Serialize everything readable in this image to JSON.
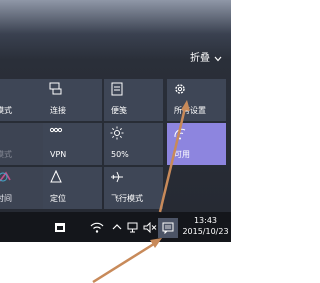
{
  "action_center": {
    "collapse_label": "折叠",
    "tiles": [
      {
        "label": "模式",
        "icon": "tablet-mode-icon"
      },
      {
        "label": "连接",
        "icon": "connect-icon"
      },
      {
        "label": "便笺",
        "icon": "note-icon"
      },
      {
        "label": "所有设置",
        "icon": "gear-icon"
      },
      {
        "label": "模式",
        "icon": "battery-saver-icon"
      },
      {
        "label": "VPN",
        "icon": "vpn-icon"
      },
      {
        "label": "50%",
        "icon": "brightness-icon"
      },
      {
        "label": "可用",
        "icon": "wifi-icon",
        "active": true
      },
      {
        "label": "时间",
        "icon": "quiet-hours-icon"
      },
      {
        "label": "定位",
        "icon": "location-icon"
      },
      {
        "label": "飞行模式",
        "icon": "airplane-icon"
      }
    ]
  },
  "taskbar": {
    "time": "13:43",
    "date": "2015/10/23",
    "icons": [
      "calendar-icon",
      "wifi-icon",
      "chevron-up-icon",
      "network-icon",
      "volume-mute-icon",
      "action-center-icon"
    ]
  },
  "colors": {
    "tile": "#3e4656",
    "tile_active": "#8d85df",
    "taskbar": "#14161b",
    "arrow": "#c88a5a"
  }
}
